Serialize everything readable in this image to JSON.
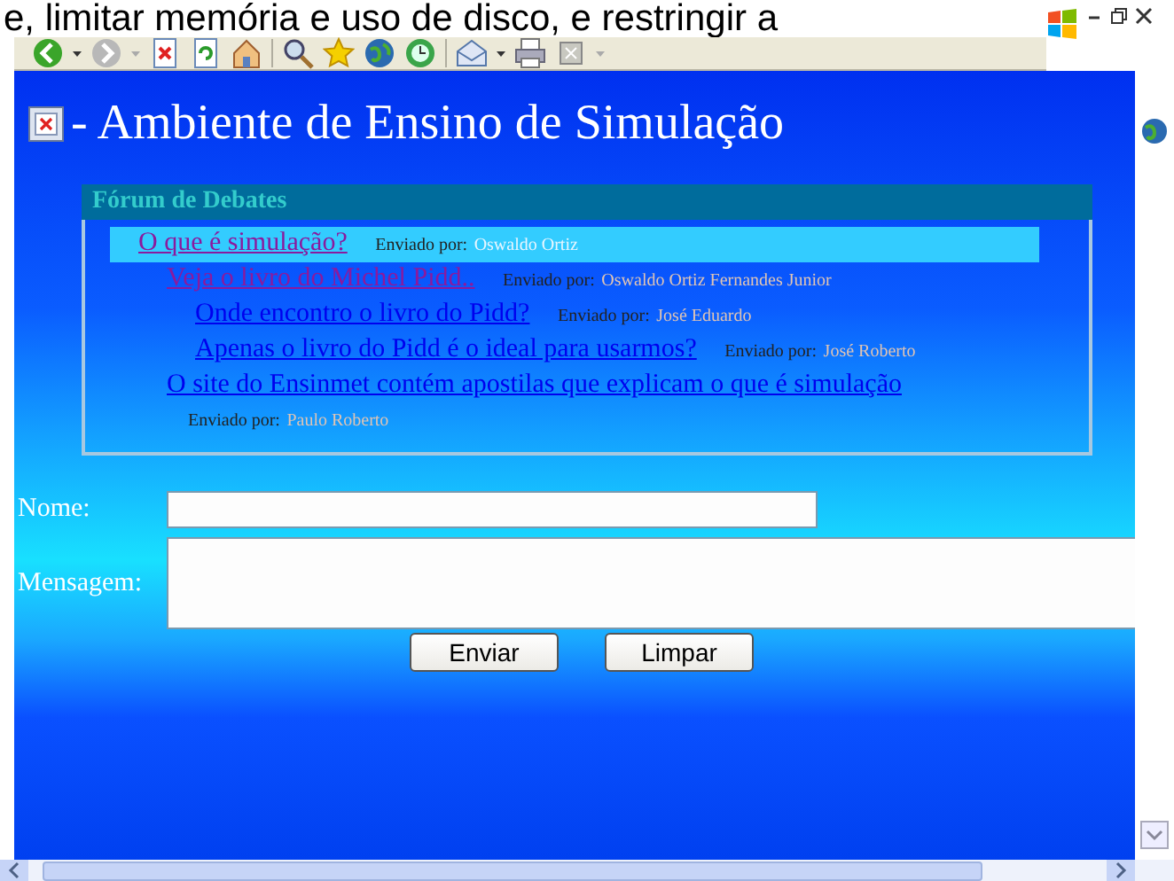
{
  "top_text": "e, limitar memória e uso de disco, e restringir a",
  "page_title": "- Ambiente de Ensino de Simulação",
  "forum": {
    "title": "Fórum de Debates",
    "posts": [
      {
        "title": "O que é simulação?",
        "by_label": "Enviado por:",
        "author": "Oswaldo Ortiz",
        "selected": true,
        "visited": true,
        "children": [
          {
            "title": "Veja o livro do Michel Pidd..",
            "by_label": "Enviado por:",
            "author": "Oswaldo Ortiz Fernandes Junior",
            "selected": false,
            "visited": true,
            "children": [
              {
                "title": "Onde encontro o livro do Pidd?",
                "by_label": "Enviado por:",
                "author": "José Eduardo",
                "selected": false,
                "visited": false
              },
              {
                "title": "Apenas o livro do Pidd é o ideal para usarmos?",
                "by_label": "Enviado por:",
                "author": "José Roberto",
                "selected": false,
                "visited": false
              }
            ]
          },
          {
            "title": "O site do Ensinmet contém apostilas que explicam o que é simulação",
            "by_label": "Enviado por:",
            "author": "Paulo Roberto",
            "selected": false,
            "visited": false
          }
        ]
      }
    ]
  },
  "form": {
    "fields": [
      {
        "label": "Nome:",
        "kind": "text"
      },
      {
        "label": "Mensagem:",
        "kind": "textarea"
      }
    ],
    "buttons": [
      "Enviar",
      "Limpar"
    ]
  }
}
